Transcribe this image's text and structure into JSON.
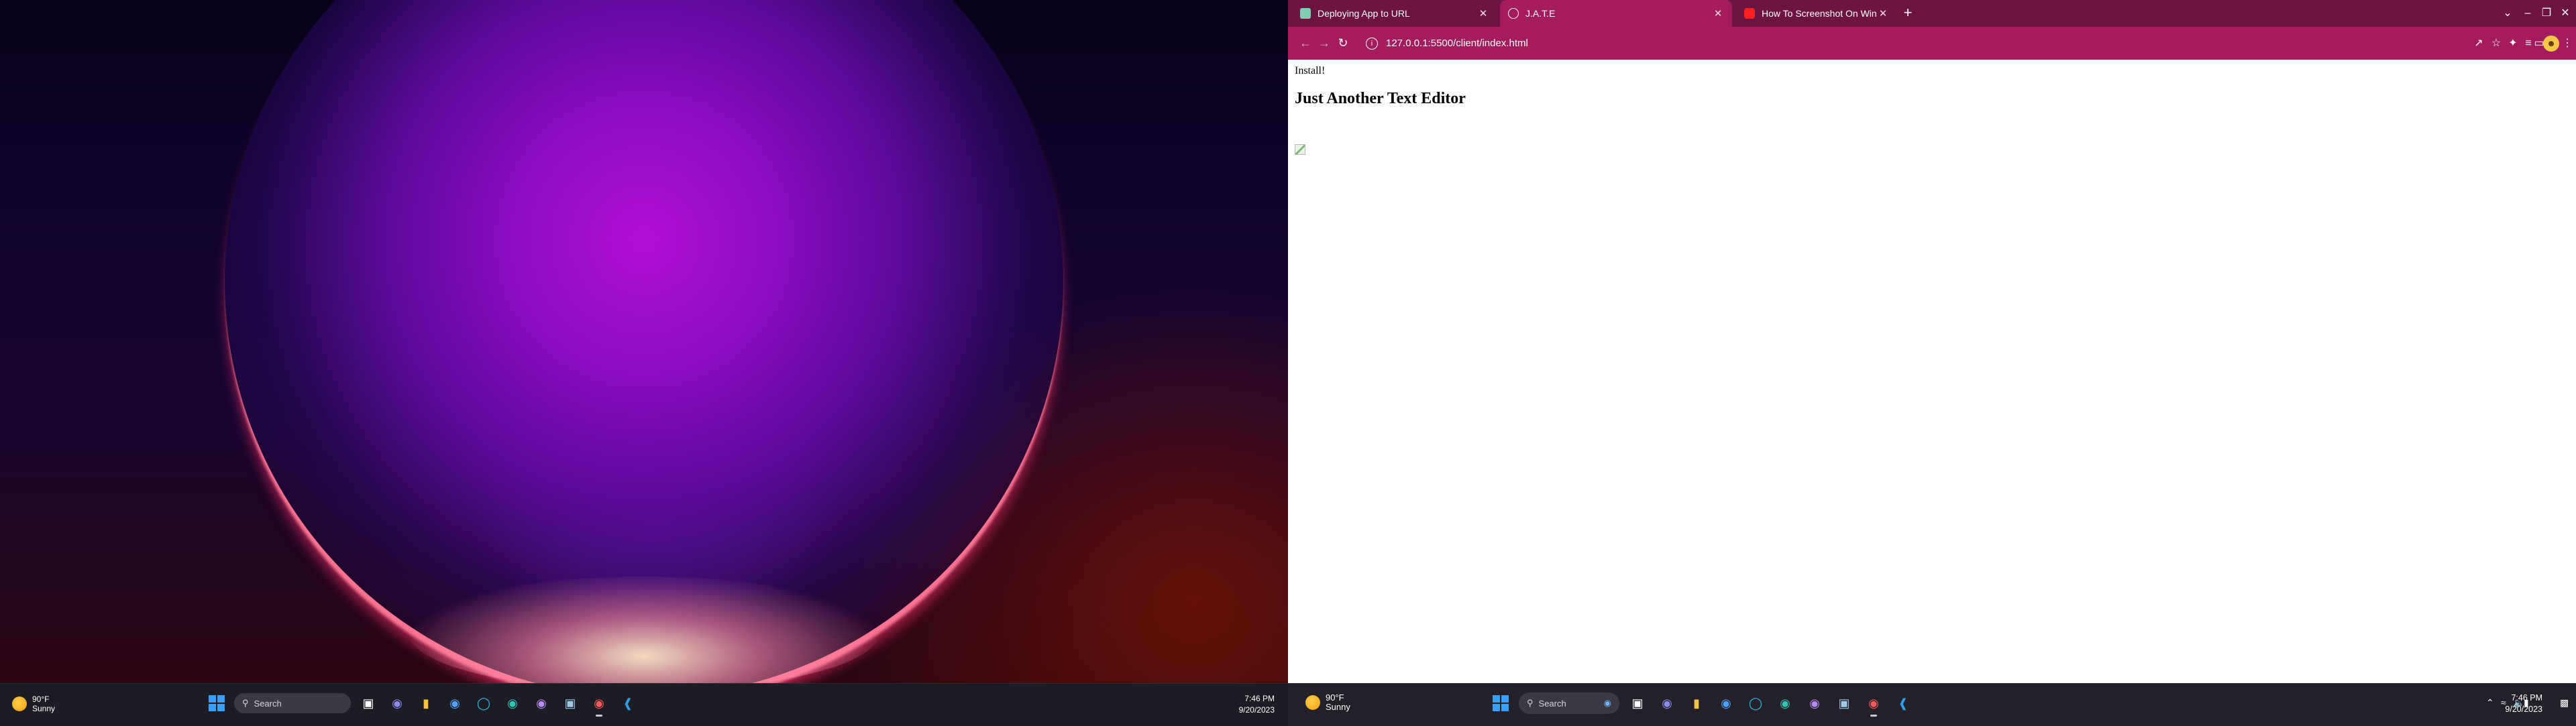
{
  "left_monitor": {
    "taskbar": {
      "weather": {
        "temp": "90°F",
        "condition": "Sunny"
      },
      "search_label": "Search",
      "clock": {
        "time": "7:46 PM",
        "date": "9/20/2023"
      }
    }
  },
  "browser": {
    "tabs": [
      {
        "title": "Deploying App to URL",
        "favicon": "doc-icon",
        "active": false
      },
      {
        "title": "J.A.T.E",
        "favicon": "globe-icon",
        "active": true
      },
      {
        "title": "How To Screenshot On Windows",
        "favicon": "youtube-icon",
        "active": false
      }
    ],
    "new_tab_label": "+",
    "url": "127.0.0.1:5500/client/index.html",
    "accent_color": "#a41c5e",
    "tabstrip_color": "#6e1442"
  },
  "page": {
    "install_label": "Install!",
    "heading": "Just Another Text Editor"
  },
  "right_monitor": {
    "taskbar": {
      "weather": {
        "temp": "90°F",
        "condition": "Sunny"
      },
      "search_label": "Search",
      "clock": {
        "time": "7:46 PM",
        "date": "9/20/2023"
      }
    }
  }
}
